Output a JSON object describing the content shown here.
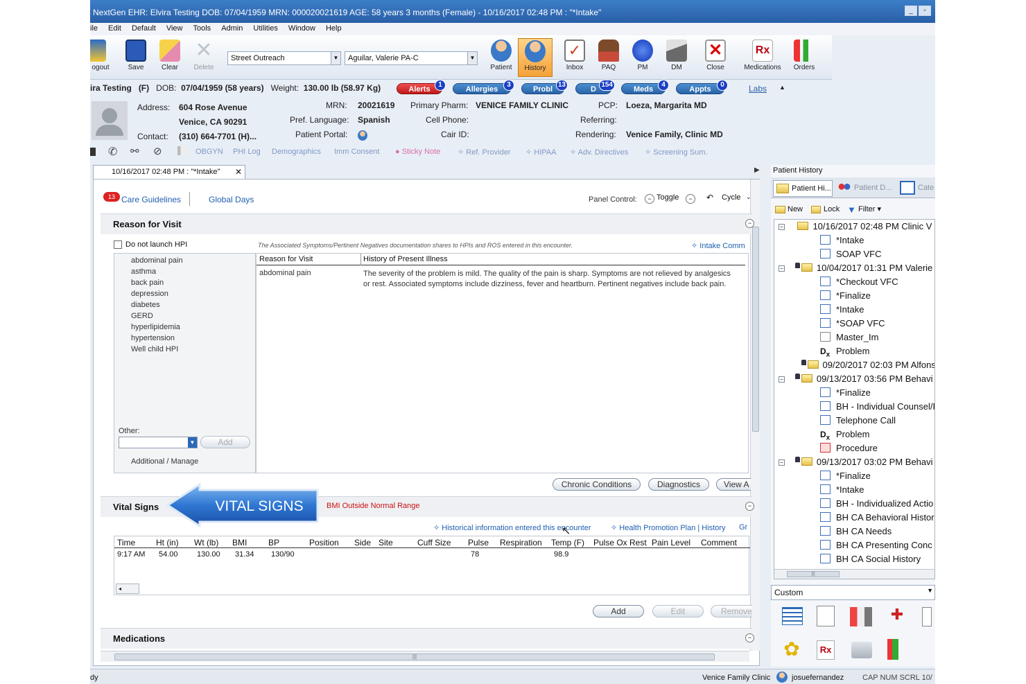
{
  "title_bar": {
    "text": "NextGen EHR: Elvira Testing  DOB: 07/04/1959  MRN: 000020021619  AGE: 58 years 3 months  (Female) - 10/16/2017 02:48 PM : \"*Intake\""
  },
  "menu": [
    "ile",
    "Edit",
    "Default",
    "View",
    "Tools",
    "Admin",
    "Utilities",
    "Window",
    "Help"
  ],
  "toolbar": {
    "logout": "ogout",
    "save": "Save",
    "clear": "Clear",
    "delete": "Delete",
    "location": "Street Outreach",
    "provider": "Aguilar, Valerie PA-C",
    "patient": "Patient",
    "history": "History",
    "inbox": "Inbox",
    "paq": "PAQ",
    "pm": "PM",
    "dm": "DM",
    "close": "Close",
    "medications": "Medications",
    "orders": "Orders"
  },
  "banner": {
    "name": "ira Testing",
    "sex": "(F)",
    "dob_label": "DOB:",
    "dob": "07/04/1959 (58 years)",
    "weight_label": "Weight:",
    "weight": "130.00 lb (58.97 Kg)",
    "address_label": "Address:",
    "address1": "604 Rose Avenue",
    "address2": "Venice, CA 90291",
    "contact_label": "Contact:",
    "contact": "(310) 664-7701 (H)...",
    "mrn_label": "MRN:",
    "mrn": "20021619",
    "lang_label": "Pref. Language:",
    "lang": "Spanish",
    "portal_label": "Patient Portal:",
    "pharm_label": "Primary Pharm:",
    "pharm": "VENICE FAMILY CLINIC",
    "cell_label": "Cell Phone:",
    "cair_label": "Cair ID:",
    "pcp_label": "PCP:",
    "pcp": "Loeza, Margarita MD",
    "referring_label": "Referring:",
    "rendering_label": "Rendering:",
    "rendering": "Venice Family, Clinic MD",
    "labs": "Labs"
  },
  "pills": [
    {
      "label": "Alerts",
      "count": "1"
    },
    {
      "label": "Allergies",
      "count": "3"
    },
    {
      "label": "Probl",
      "count": "13"
    },
    {
      "label": "D",
      "count": "154"
    },
    {
      "label": "Meds",
      "count": "4"
    },
    {
      "label": "Appts",
      "count": "0"
    }
  ],
  "nav_links": [
    "OBGYN",
    "PHI Log",
    "Demographics",
    "Imm Consent",
    "Sticky Note",
    "Ref. Provider",
    "HIPAA",
    "Adv. Directives",
    "Screening Sum."
  ],
  "encounter_tab": "10/16/2017 02:48 PM : \"*Intake\"",
  "main": {
    "badge_count": "13",
    "care_guidelines": "Care Guidelines",
    "global_days": "Global Days",
    "panel_control": "Panel Control:",
    "toggle": "Toggle",
    "cycle": "Cycle",
    "reason_header": "Reason for Visit",
    "do_not_launch": "Do not launch HPI",
    "note": "The Associated Symptoms/Pertinent Negatives documentation shares to HPIs and ROS entered in this encounter.",
    "intake_comm": "Intake Comm",
    "hpi_list": [
      "abdominal pain",
      "asthma",
      "back pain",
      "depression",
      "diabetes",
      "GERD",
      "hyperlipidemia",
      "hypertension",
      "Well child HPI"
    ],
    "other_label": "Other:",
    "add_small": "Add",
    "additional_manage": "Additional / Manage",
    "col_reason": "Reason for Visit",
    "col_hpi": "History of Present Illness",
    "row_reason": "abdominal pain",
    "row_hpi": "The severity of the problem is mild. The quality of the pain is sharp.  Symptoms are not relieved by analgesics or rest. Associated symptoms include dizziness, fever and heartburn. Pertinent negatives include back pain.",
    "chronic_conditions": "Chronic Conditions",
    "diagnostics": "Diagnostics",
    "view_a": "View A",
    "vital_header": "Vital Signs",
    "bmi_warning": "BMI Outside Normal Range",
    "historical_info": "Historical information entered this encounter",
    "health_promo": "Health Promotion Plan | History",
    "gr": "Gr",
    "vital_cols": [
      "Time",
      "Ht (in)",
      "Wt (lb)",
      "BMI",
      "BP",
      "Position",
      "Side",
      "Site",
      "Cuff Size",
      "Pulse",
      "Respiration",
      "Temp (F)",
      "Pulse Ox Rest",
      "Pain Level",
      "Comment"
    ],
    "vital_row": [
      "9:17 AM",
      "54.00",
      "130.00",
      "31.34",
      "130/90",
      "",
      "",
      "",
      "",
      "78",
      "",
      "98.9",
      "",
      "",
      ""
    ],
    "vital_add": "Add",
    "vital_edit": "Edit",
    "vital_remove": "Remove",
    "medications_header": "Medications",
    "callout": "VITAL SIGNS"
  },
  "history_panel": {
    "title": "Patient History",
    "tab1": "Patient Hi...",
    "tab2": "Patient D...",
    "tab3": "Cate",
    "new": "New",
    "lock": "Lock",
    "filter": "Filter",
    "tree": [
      {
        "kind": "folder",
        "text": "10/16/2017 02:48 PM  Clinic V"
      },
      {
        "kind": "doc",
        "text": "*Intake"
      },
      {
        "kind": "doc",
        "text": "SOAP VFC"
      },
      {
        "kind": "folder",
        "text": "10/04/2017 01:31 PM  Valerie"
      },
      {
        "kind": "doc",
        "text": "*Checkout VFC"
      },
      {
        "kind": "doc",
        "text": "*Finalize"
      },
      {
        "kind": "doc",
        "text": "*Intake"
      },
      {
        "kind": "doc",
        "text": "*SOAP VFC"
      },
      {
        "kind": "doc",
        "text": "Master_Im"
      },
      {
        "kind": "rx",
        "text": "Problem"
      },
      {
        "kind": "folder",
        "text": "09/20/2017 02:03 PM  Alfonsi"
      },
      {
        "kind": "folder",
        "text": "09/13/2017 03:56 PM  Behavi"
      },
      {
        "kind": "doc",
        "text": "*Finalize"
      },
      {
        "kind": "doc",
        "text": "BH - Individual Counsel/F"
      },
      {
        "kind": "doc",
        "text": "Telephone Call"
      },
      {
        "kind": "rx",
        "text": "Problem"
      },
      {
        "kind": "proc",
        "text": "Procedure"
      },
      {
        "kind": "folder",
        "text": "09/13/2017 03:02 PM  Behavi"
      },
      {
        "kind": "doc",
        "text": "*Finalize"
      },
      {
        "kind": "doc",
        "text": "*Intake"
      },
      {
        "kind": "doc",
        "text": "BH - Individualized Actio"
      },
      {
        "kind": "doc",
        "text": "BH CA Behavioral Histor"
      },
      {
        "kind": "doc",
        "text": "BH CA Needs"
      },
      {
        "kind": "doc",
        "text": "BH CA Presenting Conc"
      },
      {
        "kind": "doc",
        "text": "BH CA Social History"
      }
    ],
    "custom": "Custom"
  },
  "status": {
    "ready": "dy",
    "clinic": "Venice Family Clinic",
    "user": "josuefernandez",
    "caps": "CAP  NUM  SCRL  10/"
  },
  "colors": {
    "accent": "#2a5fa6",
    "alert_red": "#c01818",
    "link_blue": "#1f5fb0",
    "warning_red": "#cc1111"
  }
}
